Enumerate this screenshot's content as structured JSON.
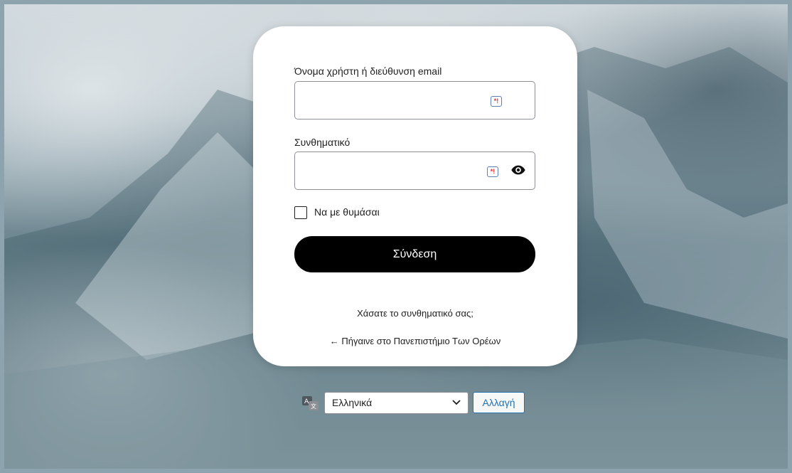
{
  "login": {
    "username_label": "Όνομα χρήστη ή διεύθυνση email",
    "username_value": "",
    "password_label": "Συνθηματικό",
    "password_value": "",
    "remember_label": "Να με θυμάσαι",
    "remember_checked": false,
    "submit_label": "Σύνδεση",
    "lost_password_link": "Χάσατε το συνθηματικό σας;",
    "back_link": "← Πήγαινε στο Πανεπιστήμιο Των Ορέων"
  },
  "language": {
    "selected": "Ελληνικά",
    "change_button": "Αλλαγή"
  },
  "icons": {
    "password_manager": "password-manager-icon",
    "show_password": "eye-icon",
    "translate": "translate-icon",
    "dropdown": "chevron-down-icon"
  },
  "colors": {
    "card_bg": "#ffffff",
    "submit_bg": "#000000",
    "link_accent": "#2271b1"
  }
}
